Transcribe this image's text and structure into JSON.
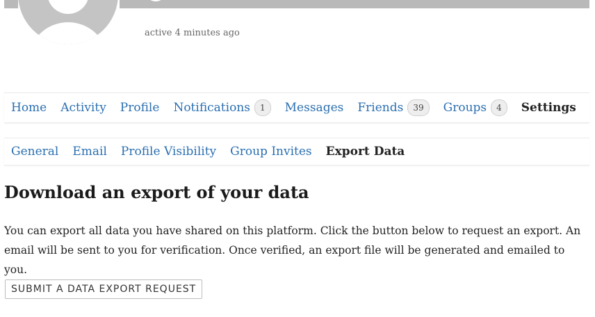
{
  "header": {
    "last_active": "active 4 minutes ago",
    "avatar_icon": "user-silhouette-icon"
  },
  "primary_nav": {
    "items": [
      {
        "label": "Home"
      },
      {
        "label": "Activity"
      },
      {
        "label": "Profile"
      },
      {
        "label": "Notifications",
        "count": "1"
      },
      {
        "label": "Messages"
      },
      {
        "label": "Friends",
        "count": "39"
      },
      {
        "label": "Groups",
        "count": "4"
      },
      {
        "label": "Settings"
      }
    ]
  },
  "sub_nav": {
    "items": [
      {
        "label": "General"
      },
      {
        "label": "Email"
      },
      {
        "label": "Profile Visibility"
      },
      {
        "label": "Group Invites"
      },
      {
        "label": "Export Data"
      }
    ]
  },
  "content": {
    "heading": "Download an export of your data",
    "description": "You can export all data you have shared on this platform. Click the button below to request an export. An email will be sent to you for verification. Once verified, an export file will be generated and emailed to you.",
    "button_label": "SUBMIT A DATA EXPORT REQUEST"
  },
  "colors": {
    "link": "#2a6fb0",
    "current": "#222222",
    "cover": "#b9b9b9"
  }
}
